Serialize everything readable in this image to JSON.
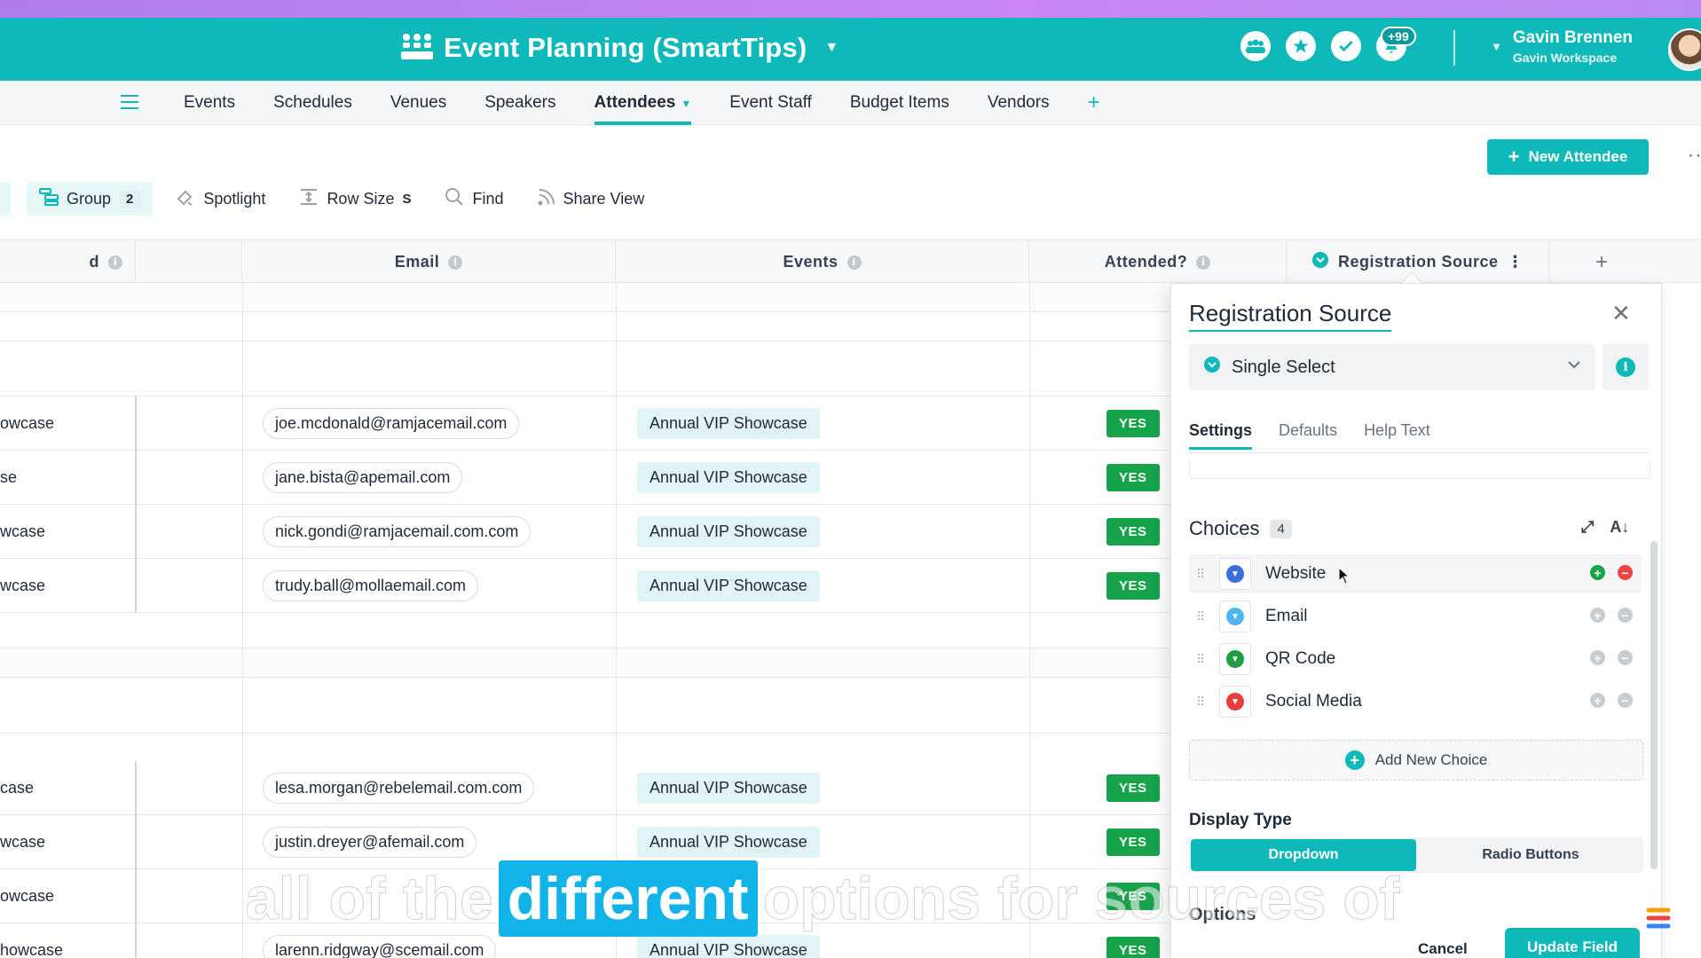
{
  "app": {
    "title": "Event Planning (SmartTips)",
    "notifications_badge": "+99",
    "user_name": "Gavin Brennen",
    "workspace": "Gavin Workspace"
  },
  "nav": {
    "tabs": [
      {
        "label": "Events"
      },
      {
        "label": "Schedules"
      },
      {
        "label": "Venues"
      },
      {
        "label": "Speakers"
      },
      {
        "label": "Attendees",
        "active": true
      },
      {
        "label": "Event Staff"
      },
      {
        "label": "Budget Items"
      },
      {
        "label": "Vendors"
      }
    ]
  },
  "actions": {
    "new_attendee": "New Attendee"
  },
  "toolbar": {
    "group_label": "Group",
    "group_count": "2",
    "spotlight": "Spotlight",
    "row_size": "Row Size",
    "row_size_value": "S",
    "find": "Find",
    "share_view": "Share View"
  },
  "grid": {
    "columns": {
      "name_partial": "d",
      "email": "Email",
      "events": "Events",
      "attended": "Attended?",
      "registration_source": "Registration Source"
    },
    "rows": [
      {
        "name": "owcase",
        "email": "joe.mcdonald@ramjacemail.com",
        "event": "Annual VIP Showcase",
        "attended": "YES"
      },
      {
        "name": "se",
        "email": "jane.bista@apemail.com",
        "event": "Annual VIP Showcase",
        "attended": "YES"
      },
      {
        "name": "wcase",
        "email": "nick.gondi@ramjacemail.com.com",
        "event": "Annual VIP Showcase",
        "attended": "YES"
      },
      {
        "name": "wcase",
        "email": "trudy.ball@mollaemail.com",
        "event": "Annual VIP Showcase",
        "attended": "YES"
      },
      {
        "name": "case",
        "email": "lesa.morgan@rebelemail.com.com",
        "event": "Annual VIP Showcase",
        "attended": "YES"
      },
      {
        "name": "wcase",
        "email": "justin.dreyer@afemail.com",
        "event": "Annual VIP Showcase",
        "attended": "YES"
      },
      {
        "name": "owcase",
        "email": "",
        "event": "",
        "attended": "YES"
      },
      {
        "name": "howcase",
        "email": "larenn.ridgway@scemail.com",
        "event": "Annual VIP Showcase",
        "attended": "YES"
      }
    ]
  },
  "panel": {
    "title": "Registration Source",
    "field_type": "Single Select",
    "tabs": [
      "Settings",
      "Defaults",
      "Help Text"
    ],
    "choices_label": "Choices",
    "choices_count": "4",
    "choices": [
      {
        "label": "Website",
        "color": "#3b6fe0"
      },
      {
        "label": "Email",
        "color": "#4fb6f0"
      },
      {
        "label": "QR Code",
        "color": "#1e9e3e"
      },
      {
        "label": "Social Media",
        "color": "#e53e3e"
      }
    ],
    "add_choice": "Add New Choice",
    "display_type_label": "Display Type",
    "display_options": [
      "Dropdown",
      "Radio Buttons"
    ],
    "options_label": "Options",
    "cancel": "Cancel",
    "update": "Update Field"
  },
  "caption": {
    "before": "all of the",
    "highlight": "different",
    "after": "options for sources of"
  },
  "colors": {
    "accent": "#10b9b9",
    "yes": "#16a34a",
    "caption_highlight": "#11b3e8"
  }
}
